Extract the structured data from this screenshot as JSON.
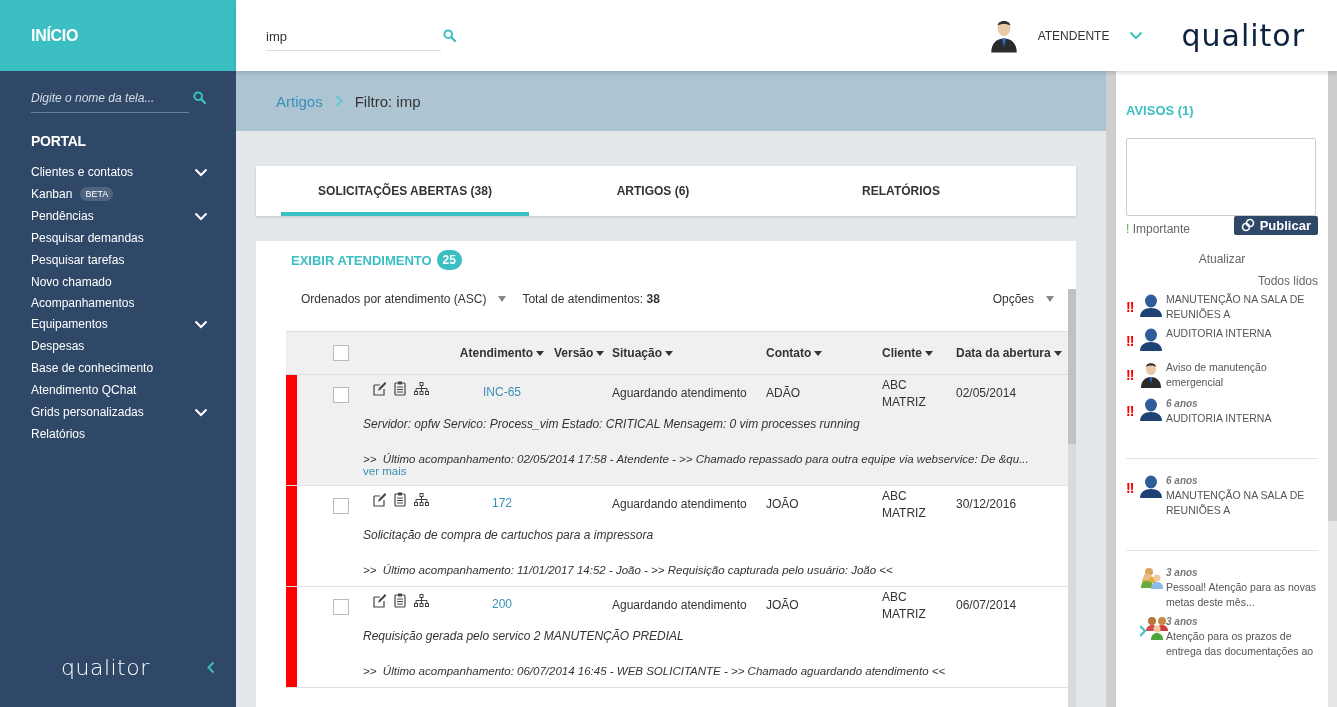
{
  "sidebar": {
    "title": "INÍCIO",
    "search": {
      "placeholder": "Digite o nome da tela..."
    },
    "section": "PORTAL",
    "items": [
      {
        "label": "Clientes e contatos",
        "expandable": true
      },
      {
        "label": "Kanban",
        "badge": "BETA",
        "expandable": false
      },
      {
        "label": "Pendências",
        "expandable": true
      },
      {
        "label": "Pesquisar demandas",
        "expandable": false
      },
      {
        "label": "Pesquisar tarefas",
        "expandable": false
      },
      {
        "label": "Novo chamado",
        "expandable": false
      },
      {
        "label": "Acompanhamentos",
        "expandable": false
      },
      {
        "label": "Equipamentos",
        "expandable": true
      },
      {
        "label": "Despesas",
        "expandable": false
      },
      {
        "label": "Base de conhecimento",
        "expandable": false
      },
      {
        "label": "Atendimento QChat",
        "expandable": false
      },
      {
        "label": "Grids personalizadas",
        "expandable": true
      },
      {
        "label": "Relatórios",
        "expandable": false
      }
    ],
    "logo": "qualitor"
  },
  "topbar": {
    "search": {
      "value": "imp"
    },
    "user": "ATENDENTE",
    "logo": "qualitor"
  },
  "breadcrumb": [
    "Artigos",
    "Filtro: imp"
  ],
  "tabs": [
    {
      "label": "SOLICITAÇÕES ABERTAS (38)",
      "selected": true
    },
    {
      "label": "ARTIGOS (6)",
      "selected": false
    },
    {
      "label": "RELATÓRIOS",
      "selected": false
    }
  ],
  "list": {
    "title": "EXIBIR ATENDIMENTO",
    "count": "25",
    "sort": "Ordenados por atendimento (ASC)",
    "total_label": "Total de atendimentos:",
    "total": "38",
    "options": "Opções",
    "select_all": {
      "checked": false
    },
    "columns": [
      "Atendimento",
      "Versão",
      "Situação",
      "Contato",
      "Cliente",
      "Data da abertura"
    ],
    "rows": [
      {
        "id": "INC-65",
        "status": "Aguardando atendimento",
        "contact": "ADÃO",
        "client": "ABC MATRIZ",
        "date": "02/05/2014",
        "description": "Servidor: opfw Servico: Process_vim Estado: CRITICAL Mensagem: 0 vim processes running",
        "last_update": ">>  Último acompanhamento: 02/05/2014 17:58 - Atendente - >> Chamado repassado para outra equipe via webservice: De &qu...",
        "more": "ver mais",
        "color": "#ff0000",
        "checked": false,
        "highlighted": true
      },
      {
        "id": "172",
        "status": "Aguardando atendimento",
        "contact": "JOÃO",
        "client": "ABC MATRIZ",
        "date": "30/12/2016",
        "description": "Solicitação de compra de cartuchos para a impressora",
        "last_update": ">>  Último acompanhamento: 11/01/2017 14:52 - João - >> Requisição capturada pelo usuário: João <<",
        "color": "#ff0000",
        "checked": false,
        "highlighted": false
      },
      {
        "id": "200",
        "status": "Aguardando atendimento",
        "contact": "JOÃO",
        "client": "ABC MATRIZ",
        "date": "06/07/2014",
        "description": "Requisição gerada pelo servico 2 MANUTENÇÃO PREDIAL",
        "last_update": ">>  Último acompanhamento: 06/07/2014 16:45 - WEB SOLICITANTE - >> Chamado aguardando atendimento <<",
        "color": "#ff0000",
        "checked": false,
        "highlighted": false
      }
    ]
  },
  "notices": {
    "title": "AVISOS (1)",
    "important_mark": "!",
    "important_label": "Importante",
    "publish": "Publicar",
    "refresh": "Atualizar",
    "mark_all": "Todos lidos",
    "items": [
      {
        "flag": "!!",
        "kind": "person",
        "text": "MANUTENÇÃO NA SALA DE REUNIÕES A",
        "divider": false
      },
      {
        "flag": "!!",
        "kind": "person",
        "text": "AUDITORIA INTERNA",
        "divider": false
      },
      {
        "flag": "!!",
        "kind": "suit",
        "text": "Aviso de manutenção emergencial",
        "divider": false
      },
      {
        "flag": "!!",
        "kind": "person",
        "age": "6 anos",
        "text": "AUDITORIA INTERNA",
        "divider": true
      },
      {
        "flag": "!!",
        "kind": "person",
        "age": "6 anos",
        "text": "MANUTENÇÃO NA SALA DE REUNIÕES A",
        "divider": true
      },
      {
        "kind": "group",
        "age": "3 anos",
        "text": "Pessoal! Atenção para as novas metas deste mês...",
        "divider": false
      },
      {
        "kind": "team",
        "age": "3 anos",
        "text": "Atenção para os prazos de entrega das documentações ao",
        "divider": false
      }
    ]
  }
}
